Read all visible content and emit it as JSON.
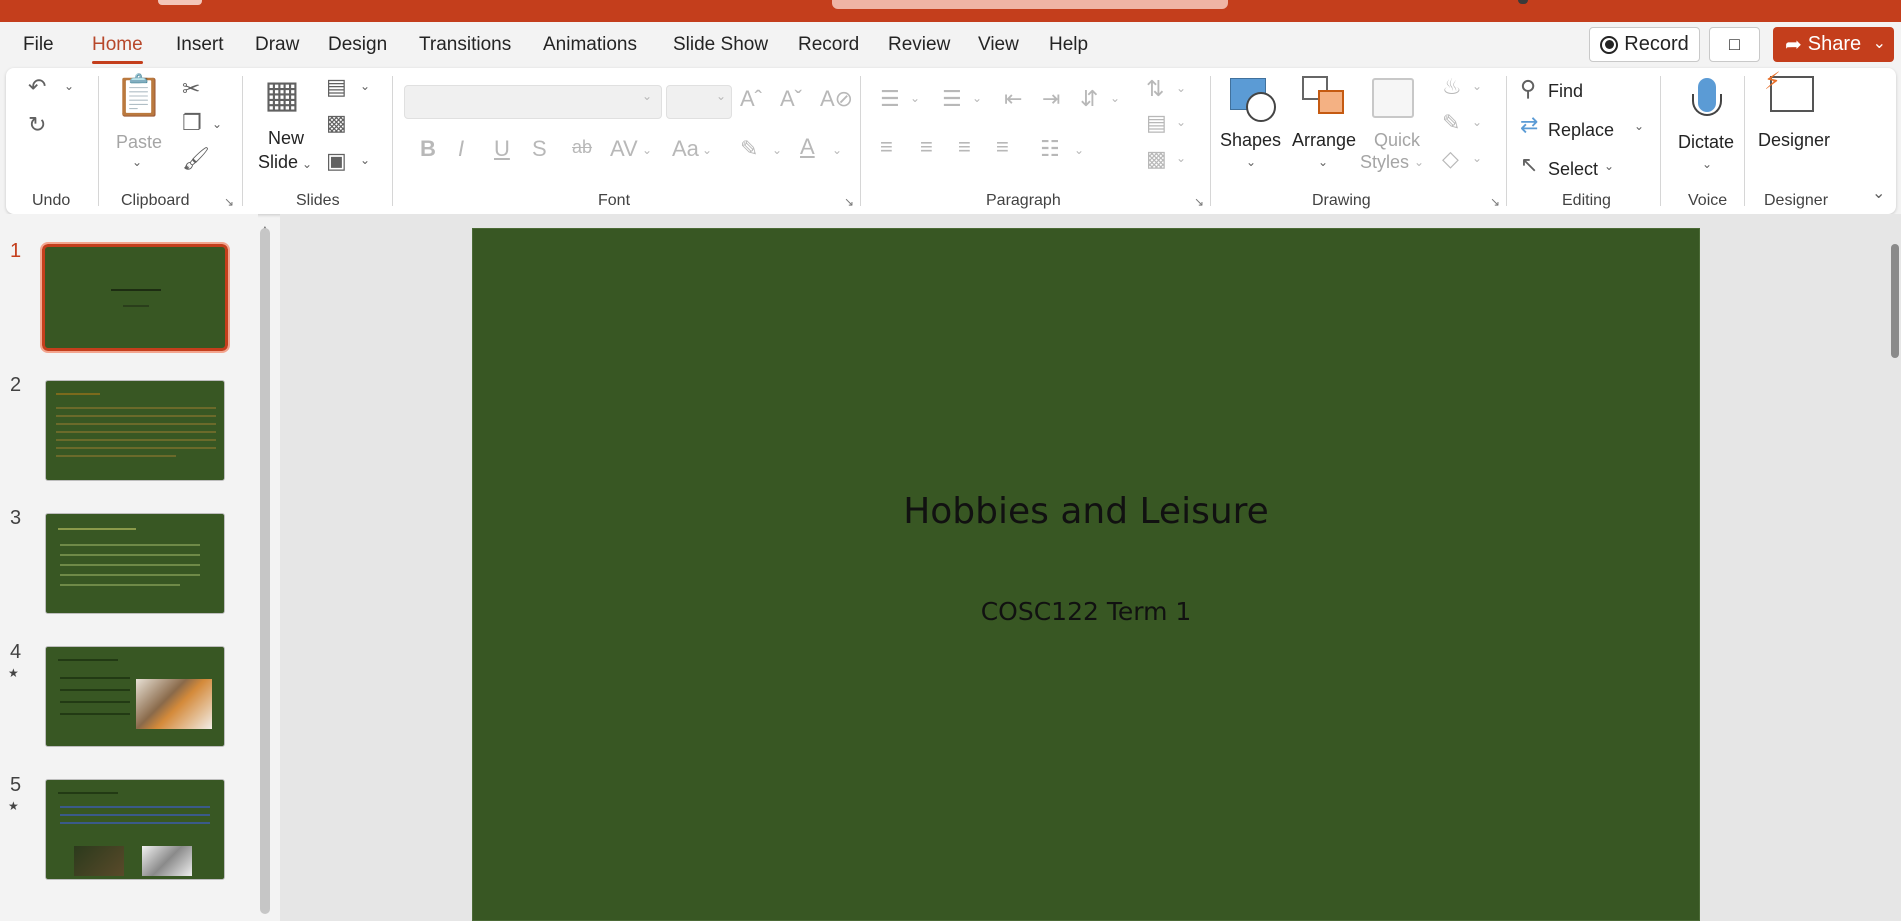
{
  "menu": {
    "tabs": [
      "File",
      "Home",
      "Insert",
      "Draw",
      "Design",
      "Transitions",
      "Animations",
      "Slide Show",
      "Record",
      "Review",
      "View",
      "Help"
    ],
    "record_label": "Record",
    "share_label": "Share"
  },
  "ribbon": {
    "undo_group": "Undo",
    "clipboard": {
      "paste": "Paste",
      "group": "Clipboard"
    },
    "slides": {
      "new_slide_1": "New",
      "new_slide_2": "Slide",
      "group": "Slides"
    },
    "font": {
      "group": "Font",
      "bold": "B",
      "italic": "I",
      "underline": "U",
      "shadow": "S",
      "strike": "ab",
      "case": "Aa",
      "font_color": "A"
    },
    "paragraph": {
      "group": "Paragraph"
    },
    "drawing": {
      "shapes": "Shapes",
      "arrange": "Arrange",
      "quick_styles_1": "Quick",
      "quick_styles_2": "Styles",
      "group": "Drawing"
    },
    "editing": {
      "find": "Find",
      "replace": "Replace",
      "select": "Select",
      "group": "Editing"
    },
    "voice": {
      "dictate": "Dictate",
      "group": "Voice"
    },
    "designer": {
      "label": "Designer",
      "group": "Designer"
    }
  },
  "thumbnails": [
    {
      "number": "1",
      "selected": true,
      "has_animation": false
    },
    {
      "number": "2",
      "selected": false,
      "has_animation": false
    },
    {
      "number": "3",
      "selected": false,
      "has_animation": false
    },
    {
      "number": "4",
      "selected": false,
      "has_animation": true
    },
    {
      "number": "5",
      "selected": false,
      "has_animation": true
    }
  ],
  "slide": {
    "title": "Hobbies and Leisure",
    "subtitle": "COSC122 Term 1",
    "background": "#385723"
  },
  "colors": {
    "accent": "#c43e1c",
    "slide_bg": "#385723"
  }
}
